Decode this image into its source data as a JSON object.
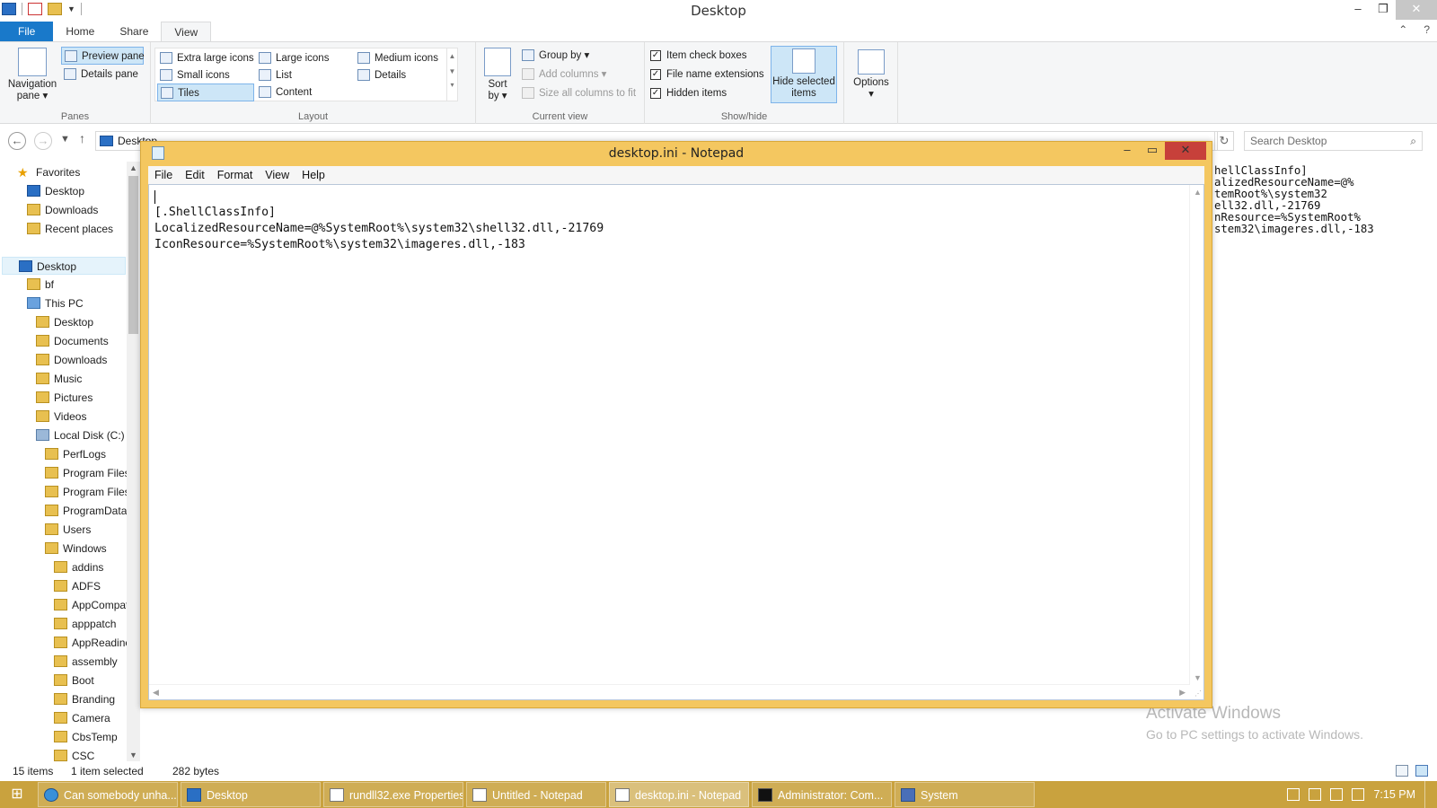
{
  "explorer": {
    "title": "Desktop",
    "ribbon_tabs": [
      "File",
      "Home",
      "Share",
      "View"
    ],
    "panes": {
      "label": "Panes",
      "navigation_pane": "Navigation pane",
      "preview_pane": "Preview pane",
      "details_pane": "Details pane"
    },
    "layout": {
      "label": "Layout",
      "options": [
        "Extra large icons",
        "Large icons",
        "Medium icons",
        "Small icons",
        "List",
        "Details",
        "Tiles",
        "Content"
      ],
      "selected": "Tiles"
    },
    "current_view": {
      "label": "Current view",
      "sort_by": "Sort by",
      "group_by": "Group by",
      "add_columns": "Add columns",
      "size_columns": "Size all columns to fit"
    },
    "show_hide": {
      "label": "Show/hide",
      "item_check_boxes": "Item check boxes",
      "file_name_extensions": "File name extensions",
      "hidden_items": "Hidden items",
      "hide_selected_items": "Hide selected items",
      "checks": [
        true,
        true,
        true
      ]
    },
    "options": "Options",
    "address": "Desktop",
    "search_placeholder": "Search Desktop",
    "nav_items": [
      {
        "label": "Favorites",
        "icon": "star-icon"
      },
      {
        "label": "Desktop",
        "icon": "desktop-icon"
      },
      {
        "label": "Downloads",
        "icon": "folder-icon"
      },
      {
        "label": "Recent places",
        "icon": "folder-icon"
      },
      {
        "label": "Desktop",
        "icon": "desktop-icon"
      },
      {
        "label": "bf",
        "icon": "folder-icon"
      },
      {
        "label": "This PC",
        "icon": "computer-icon"
      },
      {
        "label": "Desktop",
        "icon": "folder-icon"
      },
      {
        "label": "Documents",
        "icon": "folder-icon"
      },
      {
        "label": "Downloads",
        "icon": "folder-icon"
      },
      {
        "label": "Music",
        "icon": "folder-icon"
      },
      {
        "label": "Pictures",
        "icon": "folder-icon"
      },
      {
        "label": "Videos",
        "icon": "folder-icon"
      },
      {
        "label": "Local Disk (C:)",
        "icon": "disk-icon"
      },
      {
        "label": "PerfLogs",
        "icon": "folder-icon"
      },
      {
        "label": "Program Files",
        "icon": "folder-icon"
      },
      {
        "label": "Program Files",
        "icon": "folder-icon"
      },
      {
        "label": "ProgramData",
        "icon": "folder-icon"
      },
      {
        "label": "Users",
        "icon": "folder-icon"
      },
      {
        "label": "Windows",
        "icon": "folder-icon"
      },
      {
        "label": "addins",
        "icon": "folder-icon"
      },
      {
        "label": "ADFS",
        "icon": "folder-icon"
      },
      {
        "label": "AppCompat",
        "icon": "folder-icon"
      },
      {
        "label": "apppatch",
        "icon": "folder-icon"
      },
      {
        "label": "AppReadiness",
        "icon": "folder-icon"
      },
      {
        "label": "assembly",
        "icon": "folder-icon"
      },
      {
        "label": "Boot",
        "icon": "folder-icon"
      },
      {
        "label": "Branding",
        "icon": "folder-icon"
      },
      {
        "label": "Camera",
        "icon": "folder-icon"
      },
      {
        "label": "CbsTemp",
        "icon": "folder-icon"
      },
      {
        "label": "CSC",
        "icon": "folder-icon"
      }
    ],
    "preview_text": "hellClassInfo]\nalizedResourceName=@%\ntemRoot%\\system32\nell32.dll,-21769\nnResource=%SystemRoot%\nstem32\\imageres.dll,-183",
    "status": {
      "items": "15 items",
      "selected": "1 item selected",
      "size": "282 bytes"
    }
  },
  "notepad": {
    "title": "desktop.ini - Notepad",
    "menu": [
      "File",
      "Edit",
      "Format",
      "View",
      "Help"
    ],
    "content": "\n[.ShellClassInfo]\nLocalizedResourceName=@%SystemRoot%\\system32\\shell32.dll,-21769\nIconResource=%SystemRoot%\\system32\\imageres.dll,-183"
  },
  "watermark": {
    "line1": "Activate Windows",
    "line2": "Go to PC settings to activate Windows."
  },
  "taskbar": {
    "buttons": [
      {
        "label": "Can somebody unha...",
        "icon": "ie-icon"
      },
      {
        "label": "Desktop",
        "icon": "explorer-icon"
      },
      {
        "label": "rundll32.exe Properties",
        "icon": "properties-icon"
      },
      {
        "label": "Untitled - Notepad",
        "icon": "notepad-icon"
      },
      {
        "label": "desktop.ini - Notepad",
        "icon": "notepad-icon"
      },
      {
        "label": "Administrator: Com...",
        "icon": "cmd-icon"
      },
      {
        "label": "System",
        "icon": "system-icon"
      }
    ],
    "clock": "7:15 PM"
  }
}
